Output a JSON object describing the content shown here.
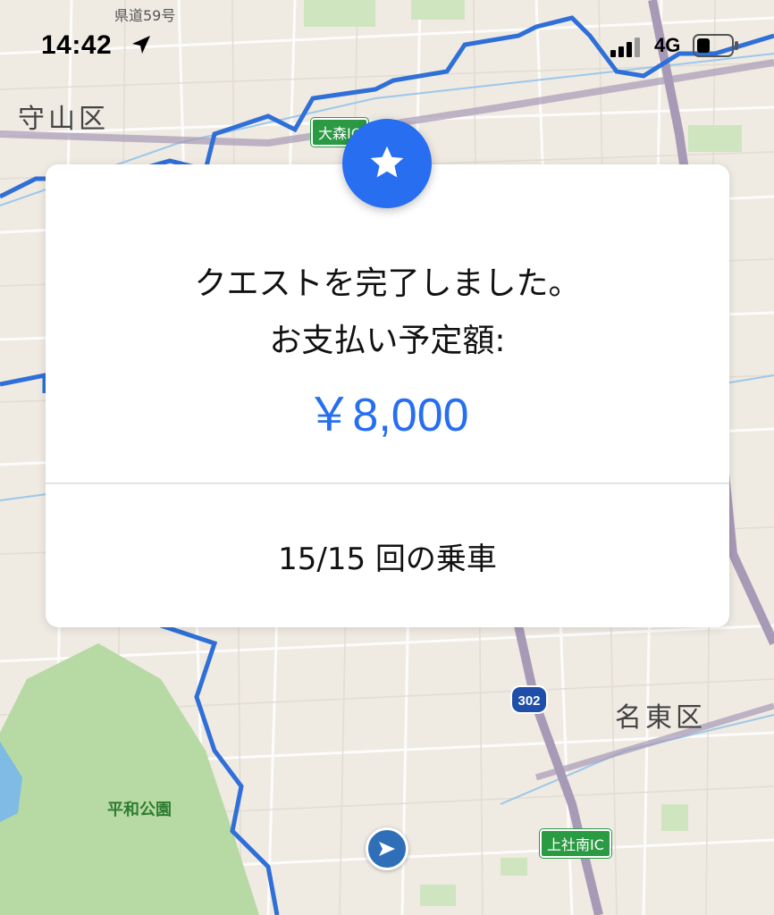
{
  "status_bar": {
    "time": "14:42",
    "network": "4G"
  },
  "map": {
    "labels": {
      "moriyama": "守山区",
      "meito": "名東区",
      "heiwa_park": "平和公園",
      "kendo_top": "県道59号"
    },
    "signs": {
      "omori_ic": "大森IC",
      "kamiyashiro_ic": "上社南IC",
      "route": "302"
    }
  },
  "quest_card": {
    "headline_1": "クエストを完了しました。",
    "headline_2": "お支払い予定額:",
    "amount": "￥8,000",
    "rides": "15/15 回の乗車",
    "accent_color": "#276ef1"
  }
}
